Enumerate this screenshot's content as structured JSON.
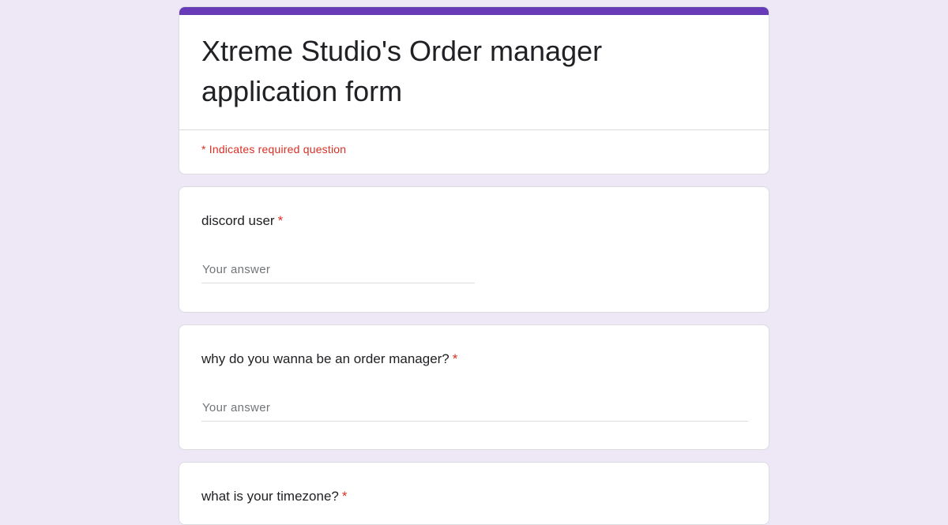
{
  "form": {
    "title": "Xtreme Studio's Order manager application form",
    "required_note": "* Indicates required question",
    "accent_color": "#673ab7",
    "background_color": "#ede7f6",
    "required_color": "#d93025"
  },
  "questions": [
    {
      "label": "discord user",
      "required_mark": "*",
      "placeholder": "Your answer",
      "value": ""
    },
    {
      "label": "why do you wanna be an order manager?",
      "required_mark": "*",
      "placeholder": "Your answer",
      "value": ""
    },
    {
      "label": "what is your timezone?",
      "required_mark": "*"
    }
  ]
}
